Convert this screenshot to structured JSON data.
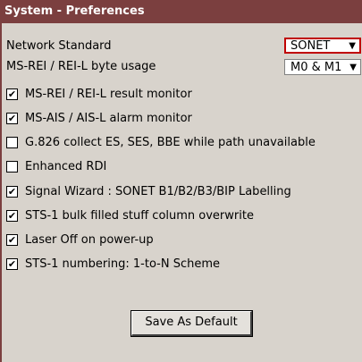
{
  "window": {
    "title": "System - Preferences"
  },
  "settings": [
    {
      "label": "Network Standard",
      "value": "SONET"
    },
    {
      "label": "MS-REI / REI-L byte usage",
      "value": "M0 & M1"
    }
  ],
  "options": [
    {
      "label": "MS-REI / REI-L result monitor",
      "checked": true
    },
    {
      "label": "MS-AIS / AIS-L alarm monitor",
      "checked": true
    },
    {
      "label": "G.826 collect ES, SES, BBE while path unavailable",
      "checked": false
    },
    {
      "label": "Enhanced RDI",
      "checked": false
    },
    {
      "label": "Signal Wizard : SONET B1/B2/B3/BIP Labelling",
      "checked": true
    },
    {
      "label": "STS-1 bulk filled stuff column overwrite",
      "checked": true
    },
    {
      "label": "Laser Off on power-up",
      "checked": true
    },
    {
      "label": "STS-1 numbering: 1-to-N Scheme",
      "checked": true
    }
  ],
  "actions": {
    "save_default": "Save As Default"
  },
  "icons": {
    "dropdown": "chevron-down-icon",
    "check": "check-icon"
  },
  "colors": {
    "titlebar": "#7b3f3f",
    "panel": "#d8d3cc",
    "focus": "#c00000"
  }
}
